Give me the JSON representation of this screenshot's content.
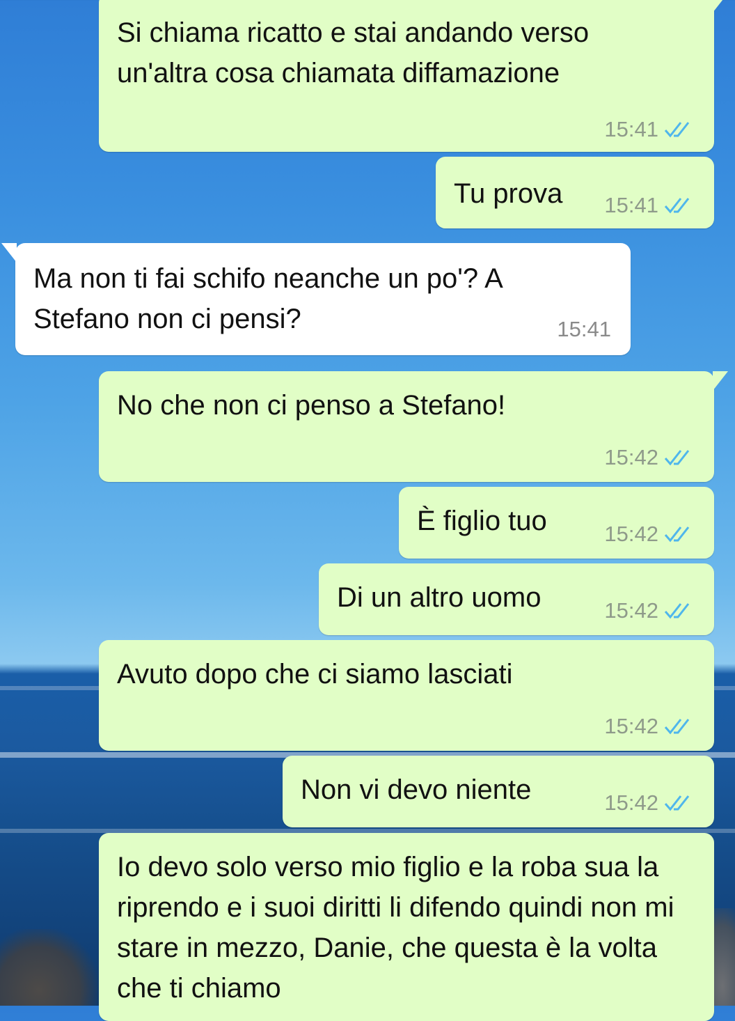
{
  "messages": [
    {
      "dir": "out",
      "text": "Si chiama ricatto e stai andando verso un'altra cosa chiamata diffamazione",
      "time": "15:41",
      "read": true
    },
    {
      "dir": "out",
      "text": "Tu prova",
      "time": "15:41",
      "read": true
    },
    {
      "dir": "in",
      "text": "Ma non ti fai schifo neanche un po'? A Stefano non ci pensi?",
      "time": "15:41"
    },
    {
      "dir": "out",
      "text": "No che non ci penso a Stefano!",
      "time": "15:42",
      "read": true
    },
    {
      "dir": "out",
      "text": "È figlio tuo",
      "time": "15:42",
      "read": true
    },
    {
      "dir": "out",
      "text": "Di un altro uomo",
      "time": "15:42",
      "read": true
    },
    {
      "dir": "out",
      "text": "Avuto dopo che ci siamo lasciati",
      "time": "15:42",
      "read": true
    },
    {
      "dir": "out",
      "text": "Non vi devo niente",
      "time": "15:42",
      "read": true
    },
    {
      "dir": "out",
      "text": "Io devo solo verso mio figlio e la roba sua la riprendo e i suoi diritti li difendo quindi non mi stare in mezzo, Danie, che questa è la volta che ti chiamo",
      "time": "",
      "read": true
    }
  ],
  "colors": {
    "outgoing_bubble": "#e1fec6",
    "incoming_bubble": "#ffffff",
    "read_ticks": "#4fb6ec",
    "timestamp": "#8e9a8a"
  },
  "icons": {
    "read_receipt": "double-check-icon"
  }
}
